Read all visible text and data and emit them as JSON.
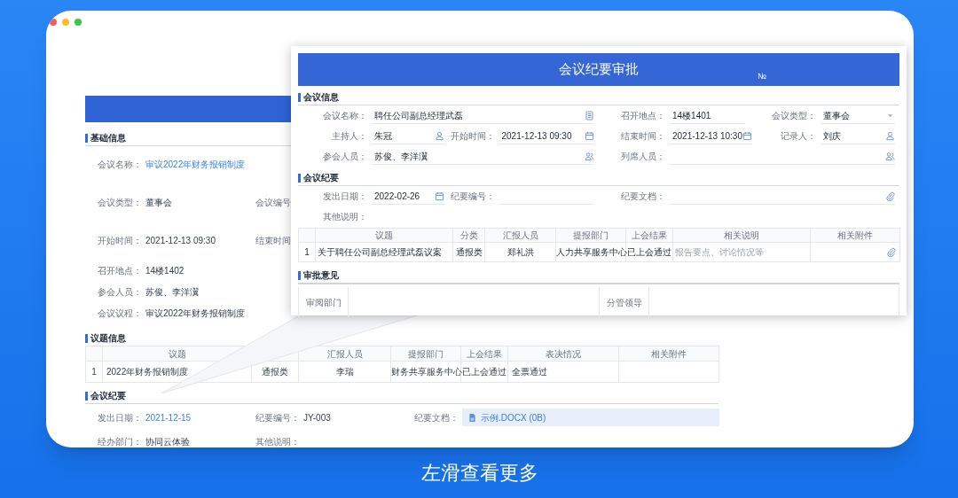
{
  "background_form": {
    "basic_info": {
      "title": "基础信息",
      "rows": [
        [
          {
            "label": "会议名称：",
            "value": "审议2022年财务报销制度",
            "kind": "link"
          }
        ],
        [
          {
            "label": "会议类型：",
            "value": "董事会",
            "kind": "text"
          },
          {
            "label": "会议编号",
            "kind": "text"
          }
        ],
        [
          {
            "label": "开始时间：",
            "value": "2021-12-13 09:30",
            "kind": "text"
          },
          {
            "label": "结束时间",
            "kind": "text"
          }
        ],
        [
          {
            "label": "召开地点：",
            "value": "14楼1402",
            "kind": "text"
          }
        ],
        [
          {
            "label": "参会人员：",
            "value": "苏俊、李洋瀷",
            "kind": "text"
          }
        ],
        [
          {
            "label": "会议议程：",
            "value": "审议2022年财务报销制度",
            "kind": "text"
          }
        ]
      ]
    },
    "topics": {
      "title": "议题信息",
      "columns": [
        {
          "label": "议题"
        },
        {},
        {
          "label": "汇报人员"
        },
        {
          "label": "提报部门"
        },
        {
          "label": "上会结果"
        },
        {
          "label": "表决情况"
        },
        {
          "label": "相关附件"
        }
      ],
      "rows": [
        {
          "index": "1",
          "cells": [
            "2022年财务报销制度",
            "通报类",
            "李瑞",
            "财务共享服务中心",
            "已上会通过",
            "全票通过"
          ]
        }
      ]
    },
    "minutes": {
      "title": "会议纪要",
      "rows": [
        [
          {
            "label": "发出日期：",
            "value": "2021-12-15",
            "kind": "link"
          },
          {
            "label": "纪要编号：",
            "value": "JY-003",
            "kind": "text"
          },
          {
            "label": "纪要文档：",
            "value": "示例.DOCX (0B)",
            "kind": "file"
          }
        ],
        [
          {
            "label": "经办部门：",
            "value": "协同云体验",
            "kind": "text"
          },
          {
            "label": "其他说明：",
            "kind": "text"
          }
        ]
      ]
    }
  },
  "popup": {
    "title": "会议纪要审批",
    "number_mark": "№",
    "info": {
      "title": "会议信息",
      "rows": [
        [
          {
            "label": "会议名称：",
            "value": "聘任公司副总经理武磊",
            "kind": "picker"
          },
          null,
          {
            "label": "召开地点：",
            "value": "14楼1401",
            "kind": "text"
          },
          {
            "label": "会议类型：",
            "value": "董事会",
            "kind": "select"
          }
        ],
        [
          {
            "label": "主持人：",
            "value": "朱冠",
            "kind": "person"
          },
          {
            "label": "开始时间：",
            "value": "2021-12-13 09:30",
            "kind": "date"
          },
          {
            "label": "结束时间：",
            "value": "2021-12-13 10:30",
            "kind": "date"
          },
          {
            "label": "记录人：",
            "value": "刘庆",
            "kind": "person"
          }
        ],
        [
          {
            "label": "参会人员：",
            "value": "苏俊、李洋瀷",
            "kind": "people"
          },
          null,
          {
            "label": "列席人员：",
            "kind": "people"
          },
          null
        ]
      ]
    },
    "minutes": {
      "title": "会议纪要",
      "rows": [
        [
          {
            "label": "发出日期：",
            "value": "2022-02-26",
            "kind": "date"
          },
          {
            "label": "纪要编号：",
            "kind": "text"
          },
          {
            "label": "纪要文档：",
            "kind": "file"
          },
          null
        ],
        [
          {
            "label": "其他说明：",
            "kind": "none"
          }
        ]
      ],
      "table": {
        "columns": [
          "议题",
          "分类",
          "汇报人员",
          "提报部门",
          "上会结果",
          "相关说明",
          "相关附件"
        ],
        "rows": [
          {
            "index": "1",
            "cells": [
              "关于聘任公司副总经理武磊议案",
              "通报类",
              "郑礼洪",
              "人力共享服务中心",
              "已上会通过"
            ],
            "note_placeholder": "报告要点、讨论情况等"
          }
        ]
      }
    },
    "approval": {
      "title": "审批意见",
      "fields": [
        {
          "label": "审阅部门"
        },
        {
          "label": "分管领导"
        }
      ]
    }
  },
  "caption": "左滑查看更多"
}
